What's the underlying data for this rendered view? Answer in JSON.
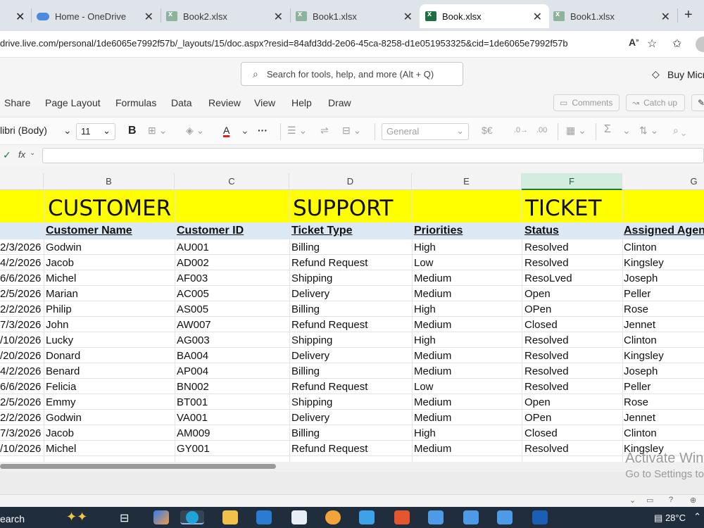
{
  "browser": {
    "tabs": [
      {
        "title": "Home - OneDrive",
        "active": false,
        "icon": "onedrive-icon"
      },
      {
        "title": "Book2.xlsx",
        "active": false,
        "icon": "excel-icon"
      },
      {
        "title": "Book1.xlsx",
        "active": false,
        "icon": "excel-icon"
      },
      {
        "title": "Book.xlsx",
        "active": true,
        "icon": "excel-icon"
      },
      {
        "title": "Book1.xlsx",
        "active": false,
        "icon": "excel-icon"
      }
    ],
    "close_glyph": "✕",
    "new_tab_glyph": "+",
    "url": "drive.live.com/personal/1de6065e7992f57b/_layouts/15/doc.aspx?resid=84afd3dd-2e06-45ca-8258-d1e051953325&cid=1de6065e7992f57b"
  },
  "app_header": {
    "search_placeholder": "Search for tools, help, and more (Alt + Q)",
    "buy_label": "Buy Micr"
  },
  "ribbon": {
    "tabs": [
      "Share",
      "Page Layout",
      "Formulas",
      "Data",
      "Review",
      "View",
      "Help",
      "Draw"
    ],
    "comments_label": "Comments",
    "catchup_label": "Catch up"
  },
  "toolbar": {
    "font_name": "libri (Body)",
    "font_size": "11",
    "bold_label": "B",
    "number_format": "General",
    "more_label": "···",
    "currency_label": "$€",
    "sum_label": "Σ"
  },
  "formula_bar": {
    "check_label": "✓",
    "fx_label": "fx"
  },
  "sheet": {
    "columns": [
      "B",
      "C",
      "D",
      "E",
      "F",
      "G"
    ],
    "selected_column": "F",
    "banner": [
      "CUSTOMER",
      "SUPPORT",
      "TICKET"
    ],
    "headers": [
      "Customer Name",
      "Customer ID",
      "Ticket Type",
      "Priorities",
      "Status",
      "Assigned Agent"
    ],
    "rows": [
      [
        "2/3/2026",
        "Godwin",
        "AU001",
        "Billing",
        "High",
        "Resolved",
        "Clinton"
      ],
      [
        "4/2/2026",
        "Jacob",
        "AD002",
        "Refund Request",
        "Low",
        "Resolved",
        "Kingsley"
      ],
      [
        "6/6/2026",
        "Michel",
        "AF003",
        "Shipping",
        "Medium",
        "ResoLved",
        "Joseph"
      ],
      [
        "2/5/2026",
        "Marian",
        "AC005",
        "Delivery",
        "Medium",
        "Open",
        "Peller"
      ],
      [
        "2/2/2026",
        "Philip",
        "AS005",
        "Billing",
        "High",
        "OPen",
        "Rose"
      ],
      [
        "7/3/2026",
        "John",
        "AW007",
        "Refund Request",
        "Medium",
        "Closed",
        "Jennet"
      ],
      [
        "/10/2026",
        "Lucky",
        "AG003",
        "Shipping",
        "High",
        "Resolved",
        "Clinton"
      ],
      [
        "/20/2026",
        "Donard",
        "BA004",
        "Delivery",
        "Medium",
        "Resolved",
        "Kingsley"
      ],
      [
        "4/2/2026",
        "Benard",
        "AP004",
        "Billing",
        "Medium",
        "Resolved",
        "Joseph"
      ],
      [
        "6/6/2026",
        "Felicia",
        "BN002",
        "Refund Request",
        "Low",
        "Resolved",
        "Peller"
      ],
      [
        "2/5/2026",
        "Emmy",
        "BT001",
        "Shipping",
        "Medium",
        "Open",
        "Rose"
      ],
      [
        "2/2/2026",
        "Godwin",
        "VA001",
        "Delivery",
        "Medium",
        "OPen",
        "Jennet"
      ],
      [
        "7/3/2026",
        "Jacob",
        "AM009",
        "Billing",
        "High",
        "Closed",
        "Clinton"
      ],
      [
        "/10/2026",
        "Michel",
        "GY001",
        "Refund Request",
        "Medium",
        "Resolved",
        "Kingsley"
      ]
    ]
  },
  "watermark": {
    "line1": "Activate Win",
    "line2": "Go to Settings to"
  },
  "taskbar": {
    "search_label": "earch",
    "weather": "28°C"
  },
  "colors": {
    "banner": "#ffff00",
    "header_row": "#dce9f5",
    "excel_green": "#1d6f42",
    "taskbar": "#1f2d3d"
  }
}
